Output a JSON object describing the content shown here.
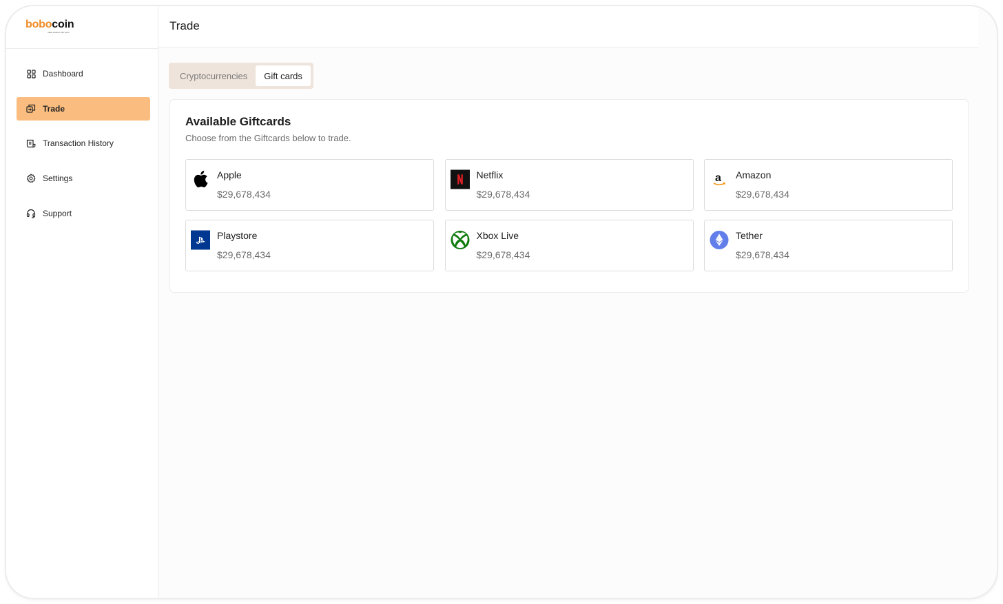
{
  "app": {
    "logo_part1": "bobo",
    "logo_part2": "coin",
    "logo_tagline": "trade smarter with bobo"
  },
  "sidebar": {
    "items": [
      {
        "label": "Dashboard",
        "icon": "grid-icon",
        "active": false
      },
      {
        "label": "Trade",
        "icon": "exchange-icon",
        "active": true
      },
      {
        "label": "Transaction History",
        "icon": "receipt-icon",
        "active": false
      },
      {
        "label": "Settings",
        "icon": "gear-icon",
        "active": false
      },
      {
        "label": "Support",
        "icon": "headset-icon",
        "active": false
      }
    ]
  },
  "header": {
    "title": "Trade"
  },
  "tabs": [
    {
      "label": "Cryptocurrencies",
      "active": false
    },
    {
      "label": "Gift cards",
      "active": true
    }
  ],
  "panel": {
    "title": "Available Giftcards",
    "subtitle": "Choose from the Giftcards below to trade."
  },
  "giftcards": [
    {
      "name": "Apple",
      "amount": "$29,678,434",
      "icon": "apple-icon"
    },
    {
      "name": "Netflix",
      "amount": "$29,678,434",
      "icon": "netflix-icon"
    },
    {
      "name": "Amazon",
      "amount": "$29,678,434",
      "icon": "amazon-icon"
    },
    {
      "name": "Playstore",
      "amount": "$29,678,434",
      "icon": "playstation-icon"
    },
    {
      "name": "Xbox Live",
      "amount": "$29,678,434",
      "icon": "xbox-icon"
    },
    {
      "name": "Tether",
      "amount": "$29,678,434",
      "icon": "ethereum-icon"
    }
  ],
  "colors": {
    "accent": "#f08a24",
    "active_nav_bg": "#fbbd7f",
    "tabs_bg": "#efe4db"
  }
}
